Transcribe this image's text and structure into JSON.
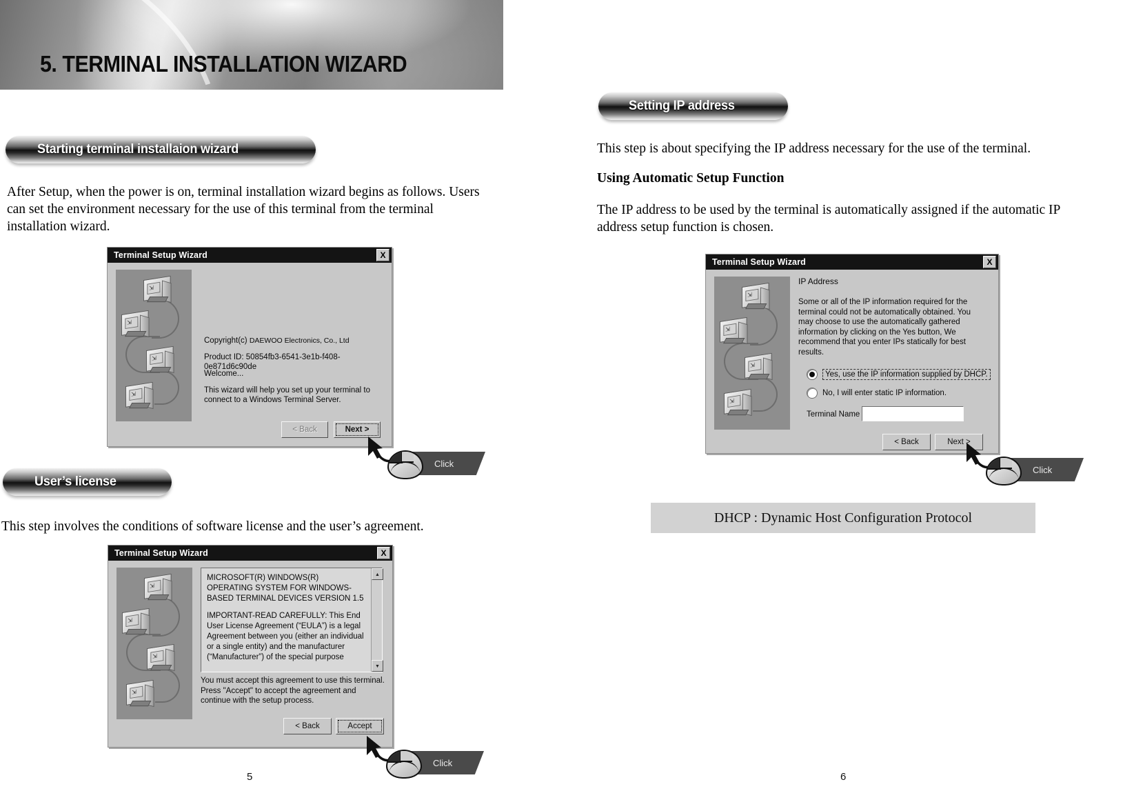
{
  "banner": {
    "title": "5. TERMINAL INSTALLATION WIZARD"
  },
  "left_page": {
    "page_number": "5",
    "pill_start": "Starting terminal installaion wizard",
    "intro_text": "After Setup, when the power is on, terminal installation wizard begins as follows. Users can set the environment necessary for the use of this terminal from the terminal installation wizard.",
    "pill_license": "User’s license",
    "license_text": "This step involves the conditions of software license and the user’s agreement.",
    "dialog_welcome": {
      "title": "Terminal Setup Wizard",
      "close_label": "X",
      "copyright_prefix": "Copyright(c)",
      "copyright_company": "DAEWOO Electronics, Co., Ltd",
      "product_id": "Product ID: 50854fb3-6541-3e1b-f408-0e871d6c90de",
      "welcome": "Welcome...",
      "description": "This wizard will help you set up your terminal to connect to a Windows Terminal Server.",
      "back_button": "< Back",
      "next_button": "Next >"
    },
    "dialog_license": {
      "title": "Terminal Setup Wizard",
      "close_label": "X",
      "eula_paragraph_1": "MICROSOFT(R) WINDOWS(R) OPERATING SYSTEM FOR WINDOWS-BASED TERMINAL DEVICES VERSION 1.5",
      "eula_paragraph_2": "IMPORTANT-READ CAREFULLY: This End User License Agreement (“EULA”) is a legal Agreement between you (either an individual or a single entity) and the manufacturer (“Manufacturer”) of the special purpose",
      "accept_note": "You must accept this agreement to use this terminal. Press \"Accept\" to accept the agreement and continue with the setup process.",
      "back_button": "< Back",
      "accept_button": "Accept",
      "scroll_up": "▲",
      "scroll_down": "▼"
    },
    "callout_next": "Click",
    "callout_accept": "Click"
  },
  "right_page": {
    "page_number": "6",
    "pill_ip": "Setting IP address",
    "ip_intro": "This step is about specifying the IP address necessary for the use of the terminal.",
    "ip_subheading": "Using Automatic Setup Function",
    "ip_body": "The IP address to be used by the terminal is automatically assigned if the automatic IP address setup function is chosen.",
    "dialog_ip": {
      "title": "Terminal Setup Wizard",
      "close_label": "X",
      "heading": "IP Address",
      "description": "Some or all of the IP information required for the terminal could not be automatically obtained. You may choose to use the automatically gathered information by clicking on the Yes button, We recommend that you enter IPs statically for best results.",
      "radio_yes": "Yes, use the IP information supplied by DHCP.",
      "radio_no": "No, I will enter static IP information.",
      "terminal_name_label": "Terminal Name",
      "terminal_name_value": "",
      "back_button": "< Back",
      "next_button": "Next >"
    },
    "note_dhcp": "DHCP : Dynamic Host Configuration Protocol",
    "callout_next": "Click"
  }
}
